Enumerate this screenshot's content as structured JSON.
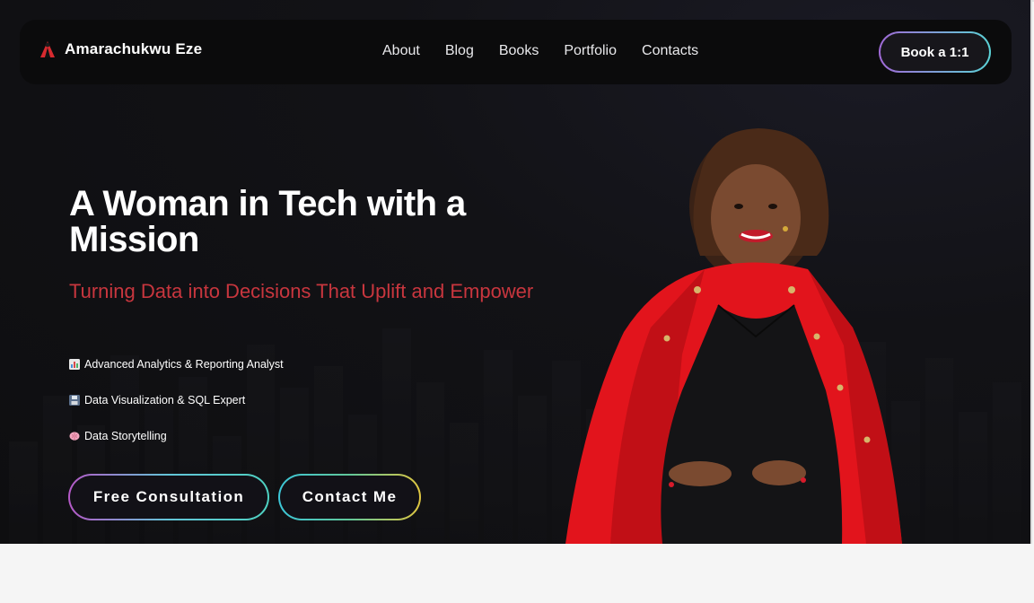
{
  "navbar": {
    "brand_name": "Amarachukwu Eze",
    "brand_icon": "figure-logo-icon",
    "links": [
      "About",
      "Blog",
      "Books",
      "Portfolio",
      "Contacts"
    ],
    "book_button": "Book a 1:1"
  },
  "hero": {
    "title": "A Woman in Tech with a Mission",
    "subtitle": "Turning Data into Decisions That Uplift and Empower",
    "features": [
      {
        "icon": "bar-chart-icon",
        "text": "Advanced Analytics & Reporting Analyst"
      },
      {
        "icon": "floppy-disk-icon",
        "text": "Data Visualization & SQL Expert"
      },
      {
        "icon": "brain-icon",
        "text": "Data Storytelling"
      }
    ],
    "cta_primary": "Free Consultation",
    "cta_secondary": "Contact Me"
  },
  "colors": {
    "background": "#0e0e10",
    "accent_red": "#c8363e",
    "gradient_purple": "#a069d6",
    "gradient_teal": "#5bd2d6",
    "gradient_yellow": "#e0c640"
  }
}
